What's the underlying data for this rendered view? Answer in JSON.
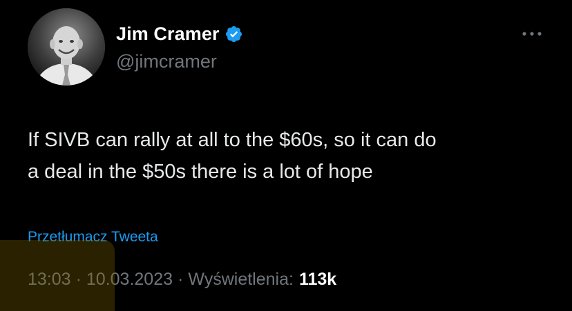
{
  "author": {
    "display_name": "Jim Cramer",
    "handle": "@jimcramer",
    "verified": true,
    "verified_color": "#1d9bf0"
  },
  "tweet": {
    "text": "If SIVB can rally at all to the $60s, so it can do\na deal in the $50s there is a lot of hope",
    "translate_label": "Przetłumacz Tweeta"
  },
  "meta": {
    "time": "13:03",
    "separator": "·",
    "date": "10.03.2023",
    "views_label": "Wyświetlenia:",
    "views_count": "113k"
  },
  "icons": {
    "more": "more-horizontal-icon",
    "verified": "verified-badge-icon"
  },
  "colors": {
    "background": "#000000",
    "text_primary": "#e7e9ea",
    "text_secondary": "#71767b",
    "link": "#1d9bf0"
  }
}
